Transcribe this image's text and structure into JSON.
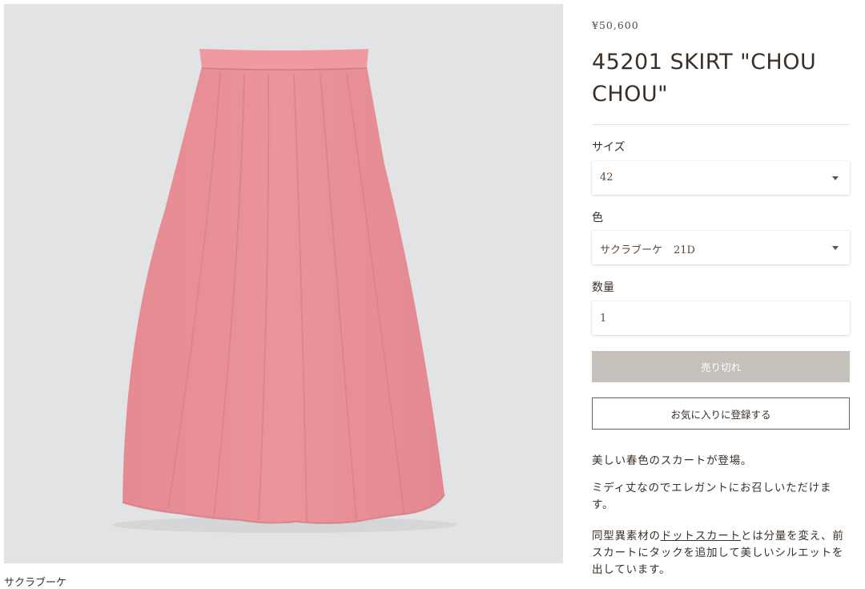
{
  "product": {
    "price": "¥50,600",
    "title": "45201 SKIRT \"CHOU CHOU\"",
    "image_caption": "サクラブーケ",
    "skirt_color": "#e99096",
    "skirt_shadow_color": "#d77c84",
    "image_background": "#e2e3e4"
  },
  "options": {
    "size_label": "サイズ",
    "size_value": "42",
    "color_label": "色",
    "color_value_name": "サクラブーケ",
    "color_value_code": "21D",
    "qty_label": "数量",
    "qty_value": "1"
  },
  "buttons": {
    "sold_out": "売り切れ",
    "favorite": "お気に入りに登録する"
  },
  "description": {
    "p1": "美しい春色のスカートが登場。",
    "p2": "ミディ丈なのでエレガントにお召しいただけます。",
    "p3_before": "同型異素材の",
    "p3_link": "ドットスカート",
    "p3_after": "とは分量を変え、前スカートにタックを追加して美しいシルエットを出しています。"
  },
  "colors": {
    "text": "#3b3027",
    "sold_out_bg": "#c5c0b9",
    "favorite_border": "#6b5d52"
  }
}
